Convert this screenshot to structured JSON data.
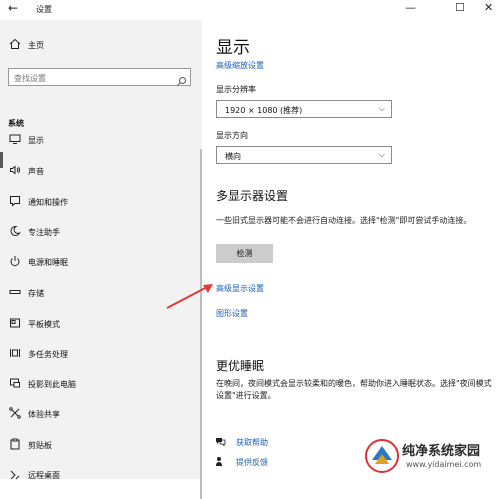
{
  "window": {
    "back": "←",
    "title": "设置",
    "minimize": "—",
    "maximize": "☐",
    "close": "✕"
  },
  "sidebar": {
    "home": "主页",
    "search_placeholder": "查找设置",
    "section": "系统",
    "items": [
      {
        "label": "显示",
        "icon": "monitor-icon"
      },
      {
        "label": "声音",
        "icon": "speaker-icon"
      },
      {
        "label": "通知和操作",
        "icon": "notification-icon"
      },
      {
        "label": "专注助手",
        "icon": "moon-icon"
      },
      {
        "label": "电源和睡眠",
        "icon": "power-icon"
      },
      {
        "label": "存储",
        "icon": "storage-icon"
      },
      {
        "label": "平板模式",
        "icon": "tablet-icon"
      },
      {
        "label": "多任务处理",
        "icon": "multitask-icon"
      },
      {
        "label": "投影到此电脑",
        "icon": "project-icon"
      },
      {
        "label": "体验共享",
        "icon": "share-icon"
      },
      {
        "label": "剪贴板",
        "icon": "clipboard-icon"
      },
      {
        "label": "远程桌面",
        "icon": "remote-icon"
      }
    ]
  },
  "main": {
    "title": "显示",
    "link_scaling": "高级缩放设置",
    "resolution_label": "显示分辨率",
    "resolution_value": "1920 × 1080 (推荐)",
    "orientation_label": "显示方向",
    "orientation_value": "横向",
    "multi_heading": "多显示器设置",
    "multi_text": "一些旧式显示器可能不会进行自动连接。选择\"检测\"即可尝试手动连接。",
    "detect_button": "检测",
    "advanced_link": "高级显示设置",
    "graphics_link": "图形设置",
    "sleep_heading": "更优睡眠",
    "sleep_text": "在晚间，夜间模式会显示较柔和的暖色，帮助你进入睡眠状态。选择\"夜间模式设置\"进行设置。",
    "help_link": "获取帮助",
    "feedback_link": "提供反馈"
  },
  "watermark": {
    "name": "纯净系统家园",
    "url": "www.yidaimei.com"
  },
  "colors": {
    "accent": "#1a5fb4",
    "arrow": "#e53935",
    "sidebar_bg": "#f2f2f2"
  }
}
